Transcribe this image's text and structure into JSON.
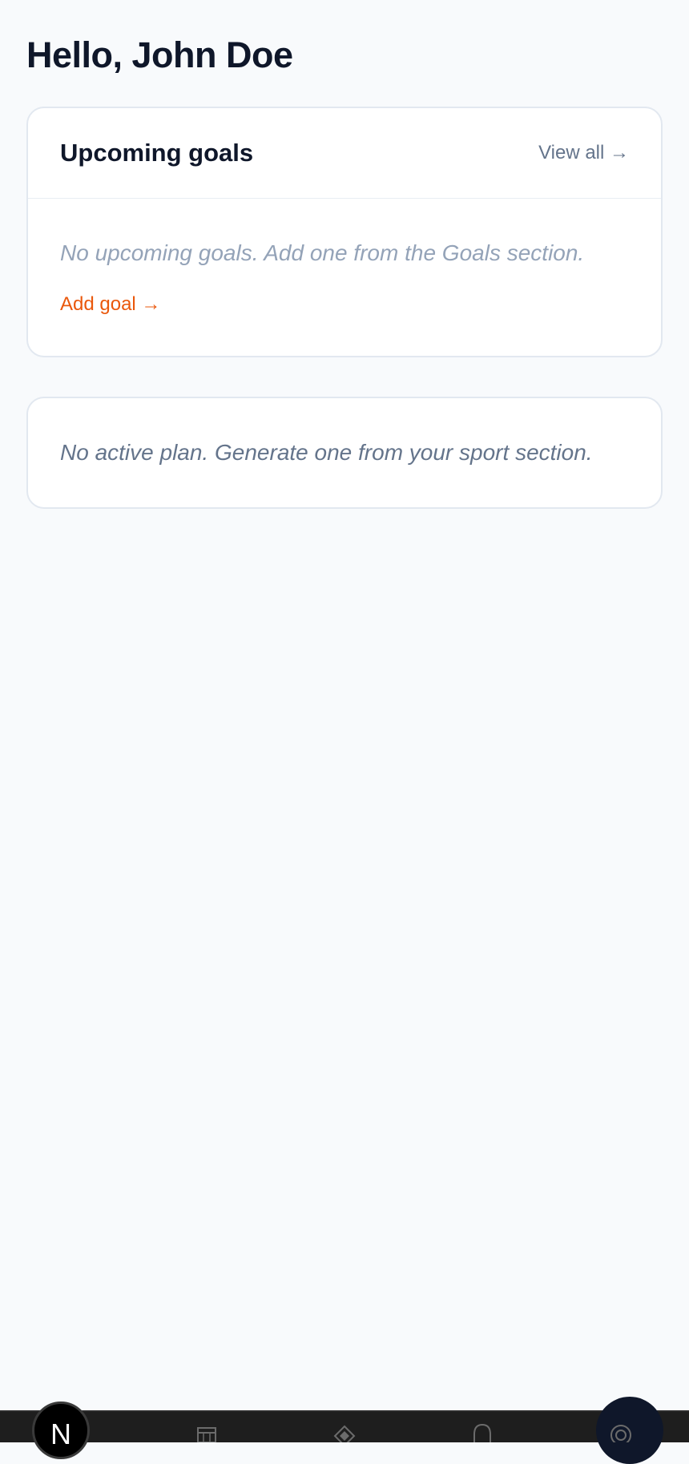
{
  "header": {
    "greeting": "Hello, John Doe"
  },
  "goals_card": {
    "title": "Upcoming goals",
    "view_all_label": "View all →",
    "empty_message": "No upcoming goals. Add one from the Goals section.",
    "add_goal_label": "Add goal →"
  },
  "plan_card": {
    "empty_message": "No active plan. Generate one from your sport section."
  },
  "bottom_nav": {
    "badge_letter": "N",
    "icons": [
      "calendar-icon",
      "diamond-icon",
      "bell-icon",
      "profile-icon"
    ]
  },
  "colors": {
    "background": "#f8fafc",
    "accent": "#ea580c",
    "text_primary": "#0f172a",
    "text_muted": "#64748b",
    "border": "#e2e8f0"
  }
}
